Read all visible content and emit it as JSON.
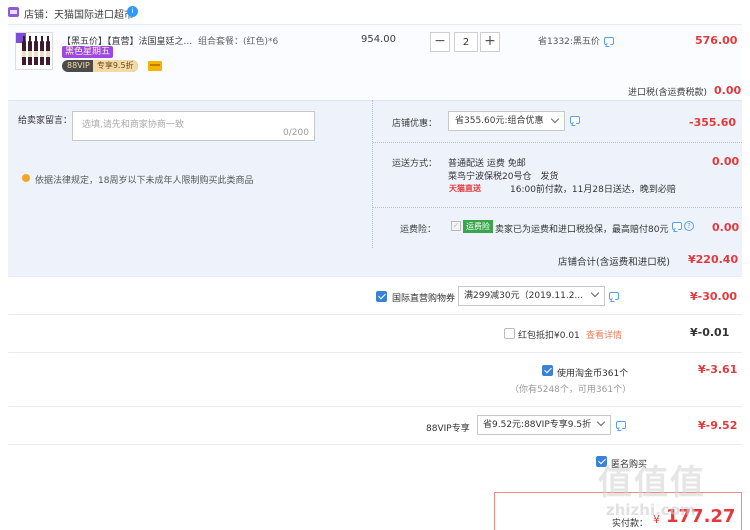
{
  "shop": {
    "label": "店铺：天猫国际进口超市",
    "chat_badge": "i"
  },
  "product": {
    "title": "【黑五价】【直营】法国皇廷之...",
    "spec": "组合套餐：(红色)*6",
    "promo_badge": "黑色星期五",
    "vip_logo": "88VIP",
    "vip_text": "专享9.5折",
    "unit_price": "954.00",
    "quantity": "2",
    "qty_minus": "−",
    "qty_plus": "+",
    "saving": "省1332:黑五价",
    "subtotal": "576.00"
  },
  "import_tax": {
    "label": "进口税(含运费税款)",
    "value": "0.00"
  },
  "message": {
    "label": "给卖家留言：",
    "placeholder": "选填,请先和商家协商一致",
    "count": "0/200"
  },
  "warning": "依据法律规定，18周岁以下未成年人限制购买此类商品",
  "shop_coupon": {
    "label": "店铺优惠：",
    "selected": "省355.60元:组合优惠",
    "value": "-355.60"
  },
  "shipping": {
    "label": "运送方式：",
    "method": "普通配送 运费 免邮",
    "warehouse": "菜鸟宁波保税20号仓　发货",
    "tmall_logo": "天猫直送",
    "delivery_note": "16:00前付款，11月28日送达，晚到必赔",
    "value": "0.00"
  },
  "insurance": {
    "label": "运费险：",
    "check": "✓",
    "badge": "运费险",
    "text": "卖家已为运费和进口税投保，最高赔付80元",
    "help": "?",
    "value": "0.00"
  },
  "shop_total": {
    "label": "店铺合计(含运费和进口税)",
    "value": "¥220.40"
  },
  "intl_coupon": {
    "label": "国际直营购物券",
    "selected": "满299减30元（2019.11.2...",
    "value": "¥-30.00"
  },
  "red_packet": {
    "label": "红包抵扣¥0.01",
    "link": "查看详情",
    "value": "¥-0.01"
  },
  "taojinbi": {
    "label": "使用淘金币361个",
    "note": "（你有5248个，可用361个）",
    "value": "¥-3.61"
  },
  "vip88": {
    "label": "88VIP专享",
    "selected": "省9.52元:88VIP专享9.5折",
    "value": "¥-9.52"
  },
  "anonymous": {
    "label": "匿名购买"
  },
  "final": {
    "label": "实付款：",
    "currency": "¥",
    "amount": "177.27"
  },
  "watermark": {
    "text": "值值值",
    "url": "zhizhi.com"
  }
}
